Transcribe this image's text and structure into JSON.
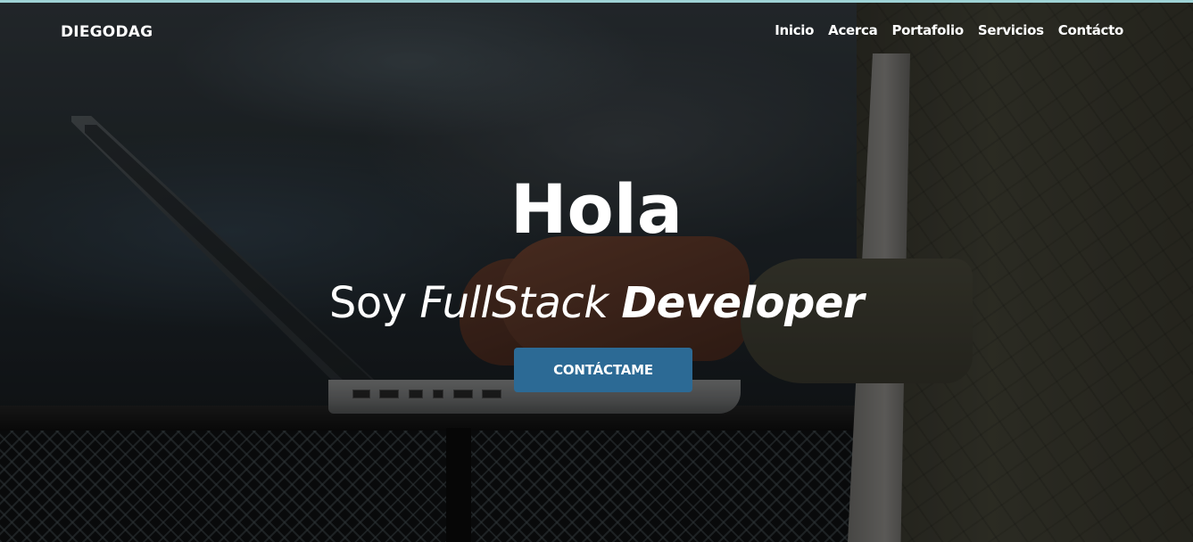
{
  "brand": "DIEGODAG",
  "nav": {
    "items": [
      "Inicio",
      "Acerca",
      "Portafolio",
      "Servicios",
      "Contácto"
    ]
  },
  "hero": {
    "title": "Hola",
    "subtitle": {
      "part1": "Soy",
      "part2": "FullStack",
      "part3": "Developer"
    },
    "cta_label": "CONTÁCTAME"
  },
  "colors": {
    "accent_button": "#2c6a95",
    "top_line": "#9fd3d6",
    "text": "#ffffff"
  }
}
